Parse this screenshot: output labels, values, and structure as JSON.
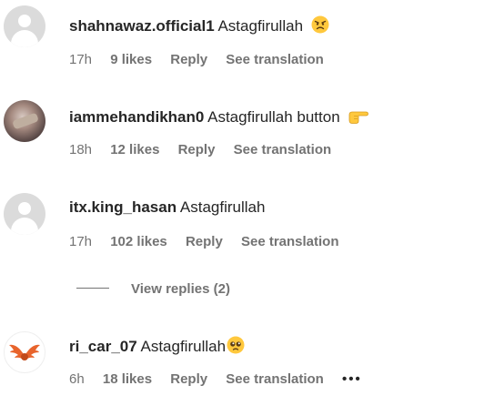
{
  "comments": [
    {
      "username": "shahnawaz.official1",
      "text": "Astagfirullah",
      "emoji_icon": "angry-face-emoji",
      "time": "17h",
      "likes": "9 likes",
      "reply_label": "Reply",
      "translation_label": "See translation",
      "avatar": "default-avatar"
    },
    {
      "username": "iammehandikhan0",
      "text": "Astagfirullah button",
      "emoji_icon": "pointing-right-hand-emoji",
      "time": "18h",
      "likes": "12 likes",
      "reply_label": "Reply",
      "translation_label": "See translation",
      "avatar": "photo-avatar"
    },
    {
      "username": "itx.king_hasan",
      "text": "Astagfirullah",
      "time": "17h",
      "likes": "102 likes",
      "reply_label": "Reply",
      "translation_label": "See translation",
      "avatar": "default-avatar",
      "view_replies": "View replies (2)"
    },
    {
      "username": "ri_car_07",
      "text": "Astagfirullah",
      "emoji_icon": "pleading-face-emoji",
      "time": "6h",
      "likes": "18 likes",
      "reply_label": "Reply",
      "translation_label": "See translation",
      "avatar": "winged-logo-avatar",
      "more_icon": "more-options-icon"
    }
  ],
  "colors": {
    "text_primary": "#262626",
    "text_secondary": "#737373",
    "avatar_placeholder": "#dbdbdb",
    "emoji_yellow": "#ffc83d",
    "logo_orange": "#e8642c"
  }
}
